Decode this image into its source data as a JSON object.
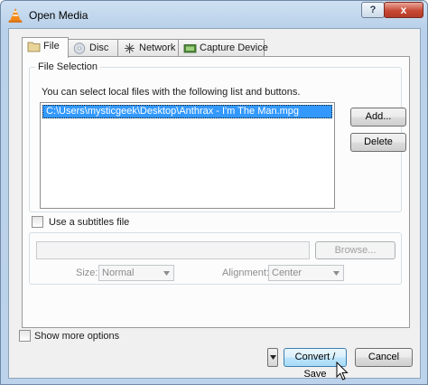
{
  "window": {
    "title": "Open Media",
    "help_label": "?",
    "close_label": "x"
  },
  "tabs": [
    {
      "label": "File",
      "icon": "folder-icon"
    },
    {
      "label": "Disc",
      "icon": "disc-icon"
    },
    {
      "label": "Network",
      "icon": "network-icon"
    },
    {
      "label": "Capture Device",
      "icon": "capture-device-icon"
    }
  ],
  "file_selection": {
    "title": "File Selection",
    "description": "You can select local files with the following list and buttons.",
    "files": [
      "C:\\Users\\mysticgeek\\Desktop\\Anthrax - I'm The Man.mpg"
    ],
    "add_label": "Add...",
    "delete_label": "Delete"
  },
  "subtitles": {
    "checkbox_label": "Use a subtitles file",
    "browse_label": "Browse...",
    "size_label": "Size:",
    "size_value": "Normal",
    "alignment_label": "Alignment:",
    "alignment_value": "Center"
  },
  "footer": {
    "show_more_label": "Show more options",
    "convert_label": "Convert / Save",
    "cancel_label": "Cancel"
  }
}
